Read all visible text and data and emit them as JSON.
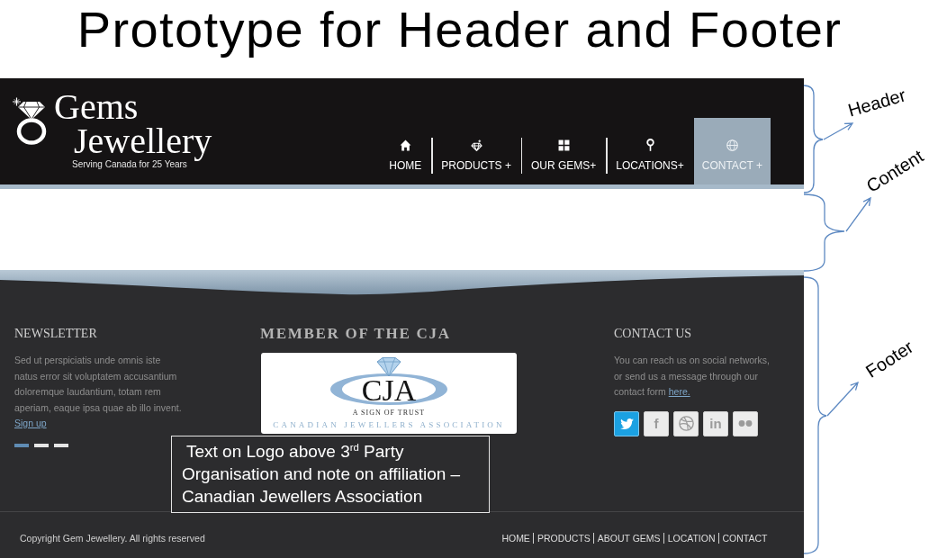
{
  "title": "Prototype for Header and Footer",
  "header": {
    "brand": [
      "Gems",
      "Jewellery"
    ],
    "tagline": "Serving Canada for 25 Years",
    "nav": [
      {
        "label": "HOME",
        "selected": false
      },
      {
        "label": "PRODUCTS +",
        "selected": false
      },
      {
        "label": "OUR GEMS+",
        "selected": false
      },
      {
        "label": "LOCATIONS+",
        "selected": false
      },
      {
        "label": "CONTACT +",
        "selected": true
      }
    ]
  },
  "footer": {
    "newsletter": {
      "heading": "NEWSLETTER",
      "text": "Sed ut perspiciatis unde omnis iste natus error sit voluptatem accusantium doloremque laudantium, totam rem aperiam, eaque ipsa quae ab illo invent.",
      "link": "Sign up",
      "slides": [
        {
          "selected": true
        },
        {
          "selected": false
        },
        {
          "selected": false
        }
      ]
    },
    "membership": {
      "heading": "MEMBER OF THE CJA",
      "logo": {
        "acronym": "CJA",
        "motto": "A SIGN OF TRUST",
        "caption": "CANADIAN JEWELLERS ASSOCIATION"
      }
    },
    "callout": "Text on Logo above 3$^{rd}$ Party Organisation and note on affiliation – Canadian Jewellers Association",
    "contact": {
      "heading": "CONTACT US",
      "text": "You can reach us on social networks, or send us a message through our contact form",
      "link": "here.",
      "social": [
        {
          "active": true
        },
        {
          "label": "f",
          "active": false
        },
        {
          "active": false
        },
        {
          "label": "in",
          "active": false
        },
        {
          "active": false
        }
      ]
    },
    "copyright": "Copyright Gem Jewellery. All rights reserved",
    "links": [
      "HOME",
      "PRODUCTS",
      "ABOUT GEMS",
      "LOCATION",
      "CONTACT"
    ]
  },
  "annotations": [
    {
      "label": "Header"
    },
    {
      "label": "Content"
    },
    {
      "label": "Footer"
    }
  ]
}
